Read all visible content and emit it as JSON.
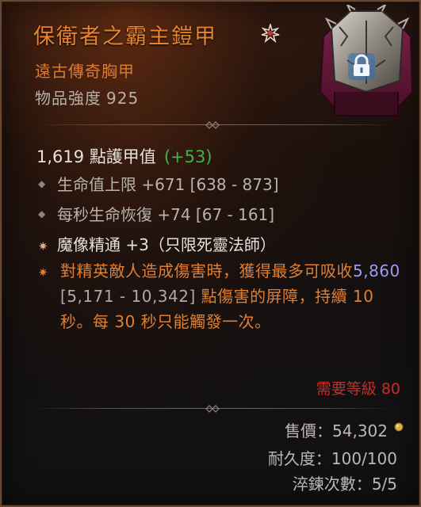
{
  "item": {
    "name": "保衛者之霸主鎧甲",
    "type": "遠古傳奇胸甲",
    "power_label": "物品強度",
    "power_value": "925",
    "legendary_icon": "legendary-star-icon",
    "lock_icon": "lock-icon"
  },
  "stats": {
    "armor_value": "1,619",
    "armor_label": "點護甲值",
    "armor_bonus": "(+53)",
    "affixes": [
      {
        "text": "生命值上限 +671 [638 - 873]"
      },
      {
        "text": "每秒生命恢復 +74 [67 - 161]"
      }
    ],
    "skill_affix": "魔像精通 +3（只限死靈法師）",
    "aspect": {
      "prefix": "對精英敵人造成傷害時，獲得最多可吸收",
      "value": "5,860",
      "range": "[5,171 - 10,342]",
      "suffix_line": "點傷害的",
      "suffix": "屏障，持續 10 秒。每 30 秒只能觸發一次。"
    },
    "requirement": "需要等級 80"
  },
  "footer": {
    "sell_label": "售價：",
    "sell_value": "54,302",
    "durability_label": "耐久度：",
    "durability_value": "100/100",
    "tempering_label": "淬鍊次數：",
    "tempering_value": "5/5"
  },
  "colors": {
    "legendary": "#e8842e",
    "positive": "#3fb34a",
    "requirement": "#c0302a",
    "value_highlight": "#9c9cf0"
  }
}
